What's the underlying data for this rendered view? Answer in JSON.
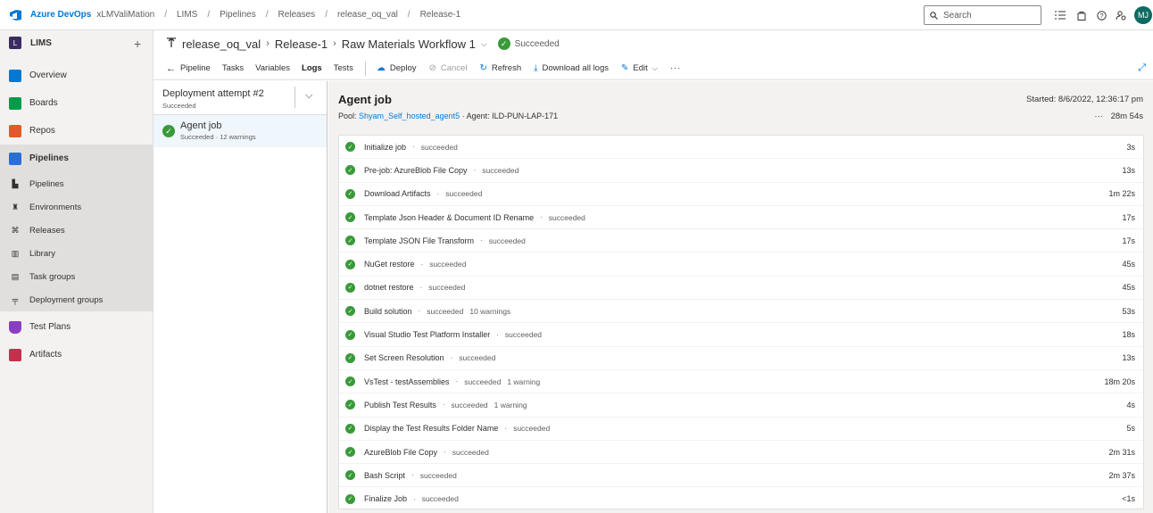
{
  "topbar": {
    "brand": "Azure DevOps",
    "org": "xLMValiMation",
    "breadcrumbs": [
      "LIMS",
      "Pipelines",
      "Releases",
      "release_oq_val",
      "Release-1"
    ],
    "search_placeholder": "Search",
    "avatar_initials": "MJ"
  },
  "sidebar": {
    "project_initial": "L",
    "project_name": "LIMS",
    "items": [
      {
        "label": "Overview",
        "color": "#0078d4"
      },
      {
        "label": "Boards",
        "color": "#009c4a"
      },
      {
        "label": "Repos",
        "color": "#e05a2b"
      },
      {
        "label": "Pipelines",
        "color": "#2a6fd4"
      }
    ],
    "subitems": [
      "Pipelines",
      "Environments",
      "Releases",
      "Library",
      "Task groups",
      "Deployment groups"
    ],
    "bottom_items": [
      {
        "label": "Test Plans",
        "color": "#8a3fc2"
      },
      {
        "label": "Artifacts",
        "color": "#c4314b"
      }
    ]
  },
  "header": {
    "pipeline": "release_oq_val",
    "release": "Release-1",
    "stage": "Raw Materials Workflow 1",
    "status": "Succeeded"
  },
  "toolbar": {
    "back": "Pipeline",
    "tabs": [
      "Tasks",
      "Variables",
      "Logs",
      "Tests"
    ],
    "active_tab": "Logs",
    "actions": {
      "deploy": "Deploy",
      "cancel": "Cancel",
      "refresh": "Refresh",
      "download": "Download all logs",
      "edit": "Edit"
    }
  },
  "left_panel": {
    "attempt_title": "Deployment attempt #2",
    "attempt_status": "Succeeded",
    "job_title": "Agent job",
    "job_status": "Succeeded · 12 warnings"
  },
  "job": {
    "title": "Agent job",
    "pool_label": "Pool:",
    "pool_name": "Shyam_Self_hosted_agent5",
    "agent": "· Agent: ILD-PUN-LAP-171",
    "started": "Started: 8/6/2022, 12:36:17 pm",
    "duration": "28m 54s"
  },
  "steps": [
    {
      "name": "Initialize job",
      "status": "succeeded",
      "warnings": "",
      "time": "3s"
    },
    {
      "name": "Pre-job: AzureBlob File Copy",
      "status": "succeeded",
      "warnings": "",
      "time": "13s"
    },
    {
      "name": "Download Artifacts",
      "status": "succeeded",
      "warnings": "",
      "time": "1m 22s"
    },
    {
      "name": "Template Json Header & Document ID Rename",
      "status": "succeeded",
      "warnings": "",
      "time": "17s"
    },
    {
      "name": "Template JSON File Transform",
      "status": "succeeded",
      "warnings": "",
      "time": "17s"
    },
    {
      "name": "NuGet restore",
      "status": "succeeded",
      "warnings": "",
      "time": "45s"
    },
    {
      "name": "dotnet restore",
      "status": "succeeded",
      "warnings": "",
      "time": "45s"
    },
    {
      "name": "Build solution",
      "status": "succeeded",
      "warnings": "10 warnings",
      "time": "53s"
    },
    {
      "name": "Visual Studio Test Platform Installer",
      "status": "succeeded",
      "warnings": "",
      "time": "18s"
    },
    {
      "name": "Set Screen Resolution",
      "status": "succeeded",
      "warnings": "",
      "time": "13s"
    },
    {
      "name": "VsTest - testAssemblies",
      "status": "succeeded",
      "warnings": "1 warning",
      "time": "18m 20s"
    },
    {
      "name": "Publish Test Results",
      "status": "succeeded",
      "warnings": "1 warning",
      "time": "4s"
    },
    {
      "name": "Display the Test Results Folder Name",
      "status": "succeeded",
      "warnings": "",
      "time": "5s"
    },
    {
      "name": "AzureBlob File Copy",
      "status": "succeeded",
      "warnings": "",
      "time": "2m 31s"
    },
    {
      "name": "Bash Script",
      "status": "succeeded",
      "warnings": "",
      "time": "2m 37s"
    },
    {
      "name": "Finalize Job",
      "status": "succeeded",
      "warnings": "",
      "time": "<1s"
    }
  ]
}
